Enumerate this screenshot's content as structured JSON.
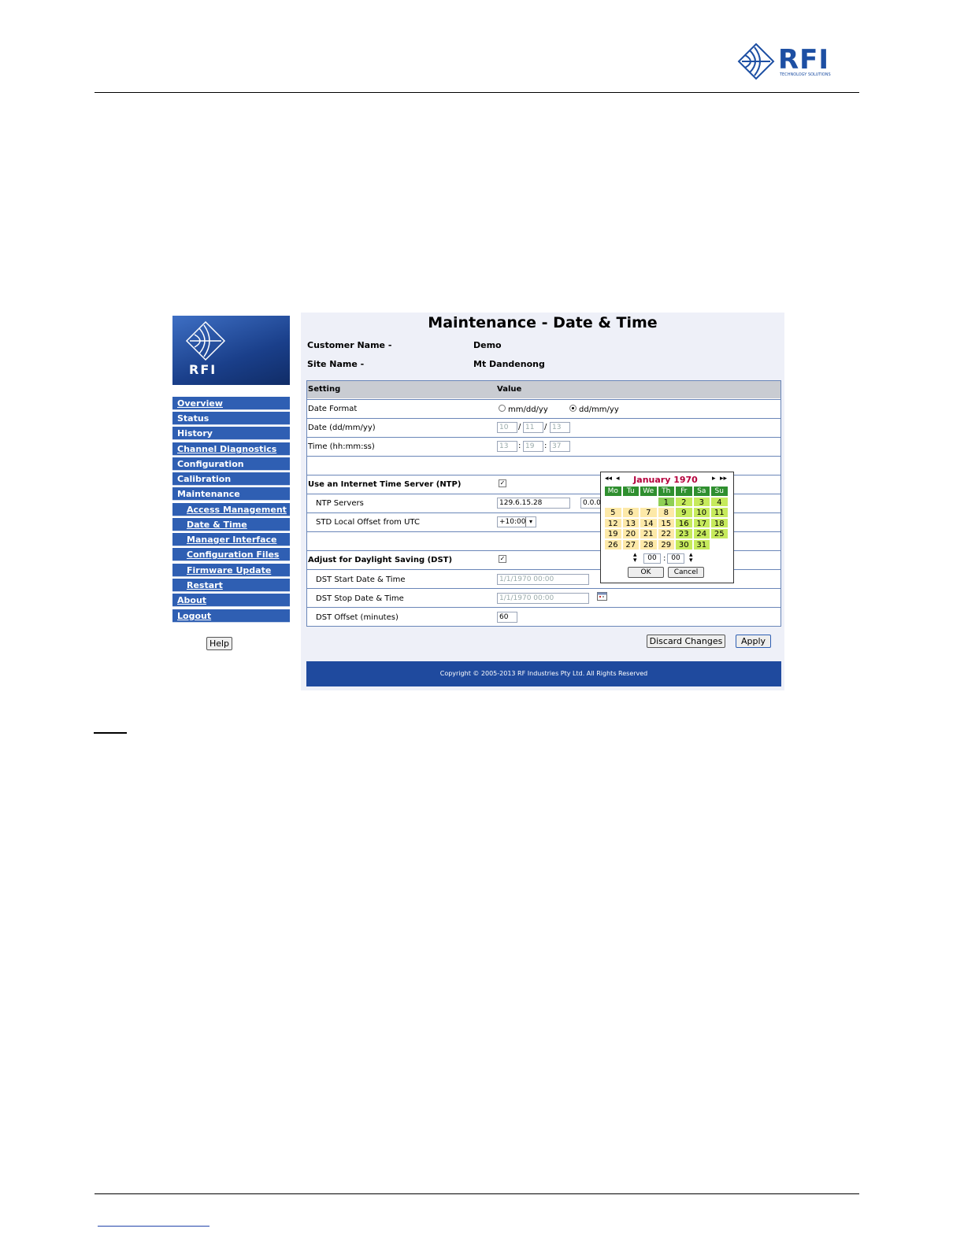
{
  "doc": {
    "logo_text": "RFI",
    "logo_subtitle": "TECHNOLOGY SOLUTIONS"
  },
  "app": {
    "logo_text": "RFI",
    "title": "Maintenance - Date & Time",
    "customer_label": "Customer Name -",
    "customer_value": "Demo",
    "site_label": "Site Name -",
    "site_value": "Mt Dandenong",
    "help_label": "Help",
    "nav": [
      {
        "label": "Overview"
      },
      {
        "label": "Status"
      },
      {
        "label": "History"
      },
      {
        "label": "Channel Diagnostics"
      },
      {
        "label": "Configuration"
      },
      {
        "label": "Calibration"
      },
      {
        "label": "Maintenance"
      },
      {
        "label": "Access Management"
      },
      {
        "label": "Date & Time"
      },
      {
        "label": "Manager Interface"
      },
      {
        "label": "Configuration Files"
      },
      {
        "label": "Firmware Update"
      },
      {
        "label": "Restart"
      },
      {
        "label": "About"
      },
      {
        "label": "Logout"
      }
    ],
    "table": {
      "col_setting": "Setting",
      "col_value": "Value",
      "date_format_label": "Date Format",
      "date_format_opt1": "mm/dd/yy",
      "date_format_opt2": "dd/mm/yy",
      "date_format_selected": "dd/mm/yy",
      "date_label": "Date (dd/mm/yy)",
      "date_dd": "10",
      "date_mm": "11",
      "date_yy": "13",
      "time_label": "Time (hh:mm:ss)",
      "time_hh": "13",
      "time_mm": "19",
      "time_ss": "37",
      "sep_slash": "/",
      "sep_colon": ":",
      "ntp_label": "Use an Internet Time Server (NTP)",
      "ntp_checked": "✓",
      "ntp_servers_label": "NTP Servers",
      "ntp_server1": "129.6.15.28",
      "ntp_server2": "0.0.0",
      "utc_offset_label": "STD Local Offset from UTC",
      "utc_offset_value": "+10:00",
      "dst_label": "Adjust for Daylight Saving (DST)",
      "dst_checked": "✓",
      "dst_start_label": "DST Start Date & Time",
      "dst_start_value": "1/1/1970 00:00",
      "dst_stop_label": "DST Stop Date & Time",
      "dst_stop_value": "1/1/1970 00:00",
      "dst_offset_label": "DST Offset (minutes)",
      "dst_offset_value": "60"
    },
    "discard_label": "Discard Changes",
    "apply_label": "Apply",
    "footer": "Copyright © 2005-2013 RF Industries Pty Ltd. All Rights Reserved",
    "calendar": {
      "title": "January 1970",
      "prev_year": "◂◂",
      "prev_month": "◂",
      "next_month": "▸",
      "next_year": "▸▸",
      "weekdays": [
        "Mo",
        "Tu",
        "We",
        "Th",
        "Fr",
        "Sa",
        "Su"
      ],
      "days": [
        "",
        "",
        "",
        "1",
        "2",
        "3",
        "4",
        "5",
        "6",
        "7",
        "8",
        "9",
        "10",
        "11",
        "12",
        "13",
        "14",
        "15",
        "16",
        "17",
        "18",
        "19",
        "20",
        "21",
        "22",
        "23",
        "24",
        "25",
        "26",
        "27",
        "28",
        "29",
        "30",
        "31"
      ],
      "hour": "00",
      "minute": "00",
      "ok_label": "OK",
      "cancel_label": "Cancel"
    }
  },
  "colors": {
    "nav_bg": "#2f5fb3",
    "footer_bg": "#1f4a9e",
    "calendar_header": "#2f8f2f",
    "calendar_title": "#b5003c"
  }
}
